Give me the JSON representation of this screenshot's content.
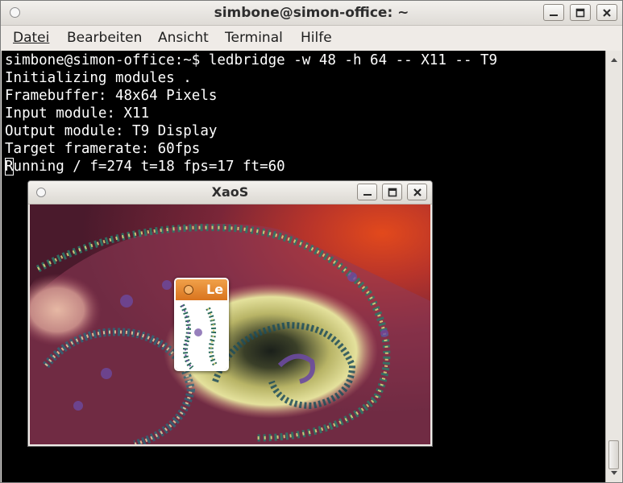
{
  "window": {
    "title": "simbone@simon-office: ~"
  },
  "menubar": {
    "items": [
      {
        "label": "Datei"
      },
      {
        "label": "Bearbeiten"
      },
      {
        "label": "Ansicht"
      },
      {
        "label": "Terminal"
      },
      {
        "label": "Hilfe"
      }
    ]
  },
  "terminal": {
    "lines": [
      "simbone@simon-office:~$ ledbridge -w 48 -h 64 -- X11 -- T9",
      "Initializing modules .",
      "Framebuffer: 48x64 Pixels",
      "Input module: X11",
      "Output module: T9 Display",
      "Target framerate: 60fps",
      "Running / f=274 t=18 fps=17 ft=60"
    ],
    "cursor_char": "R",
    "last_line_rest": "unning / f=274 t=18 fps=17 ft=60"
  },
  "xaos": {
    "title": "XaoS"
  },
  "le_window": {
    "title": "Le"
  },
  "icons": {
    "window_menu": "window-menu-icon",
    "minimize": "minimize-icon",
    "maximize": "maximize-icon",
    "close": "close-icon"
  },
  "colors": {
    "terminal_bg": "#000000",
    "terminal_fg": "#ffffff",
    "le_titlebar": "#e2852e"
  }
}
